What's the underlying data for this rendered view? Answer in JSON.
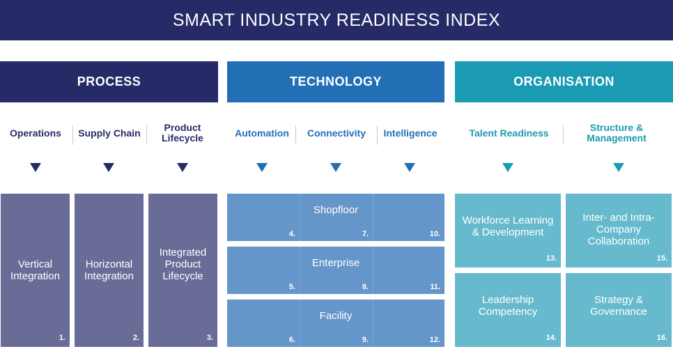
{
  "title": "SMART INDUSTRY READINESS INDEX",
  "colors": {
    "title_bg": "#262a67",
    "process": "#262a67",
    "technology": "#226fb5",
    "organisation": "#1b9ab3",
    "process_box": "#6a6c98",
    "technology_box": "#6496ca",
    "organisation_box": "#67bacd"
  },
  "pillars": [
    {
      "label": "PROCESS",
      "subs": [
        "Operations",
        "Supply Chain",
        "Product Lifecycle"
      ]
    },
    {
      "label": "TECHNOLOGY",
      "subs": [
        "Automation",
        "Connectivity",
        "Intelligence"
      ]
    },
    {
      "label": "ORGANISATION",
      "subs": [
        "Talent Readiness",
        "Structure & Management"
      ]
    }
  ],
  "process_boxes": [
    {
      "label": "Vertical Integration",
      "num": "1."
    },
    {
      "label": "Horizontal Integration",
      "num": "2."
    },
    {
      "label": "Integrated Product Lifecycle",
      "num": "3."
    }
  ],
  "technology_rows": [
    {
      "label": "Shopfloor",
      "nums": [
        "4.",
        "7.",
        "10."
      ]
    },
    {
      "label": "Enterprise",
      "nums": [
        "5.",
        "8.",
        "11."
      ]
    },
    {
      "label": "Facility",
      "nums": [
        "6.",
        "9.",
        "12."
      ]
    }
  ],
  "organisation_boxes": [
    {
      "label": "Workforce Learning & Development",
      "num": "13."
    },
    {
      "label": "Leadership Competency",
      "num": "14."
    },
    {
      "label": "Inter- and Intra-Company Collaboration",
      "num": "15."
    },
    {
      "label": "Strategy & Governance",
      "num": "16."
    }
  ]
}
